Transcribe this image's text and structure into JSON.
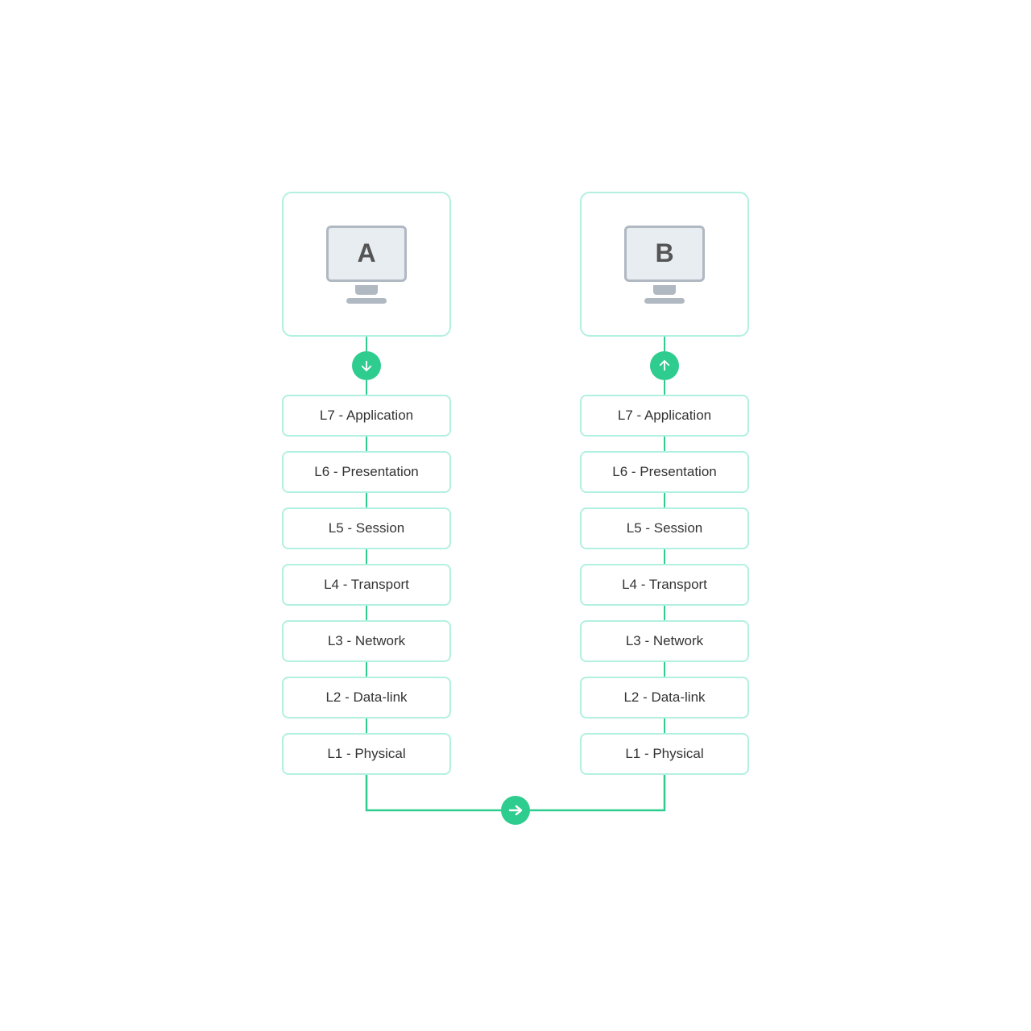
{
  "computers": [
    {
      "id": "A",
      "label": "A",
      "arrow_direction": "down"
    },
    {
      "id": "B",
      "label": "B",
      "arrow_direction": "up"
    }
  ],
  "layers": [
    "L7 - Application",
    "L6 - Presentation",
    "L5 - Session",
    "L4 - Transport",
    "L3 - Network",
    "L2 - Data-link",
    "L1 - Physical"
  ],
  "colors": {
    "green": "#2ecc8e",
    "border_light": "#b2f0e0",
    "text": "#333333",
    "monitor_border": "#b0b8c1",
    "monitor_bg": "#e8edf2"
  }
}
